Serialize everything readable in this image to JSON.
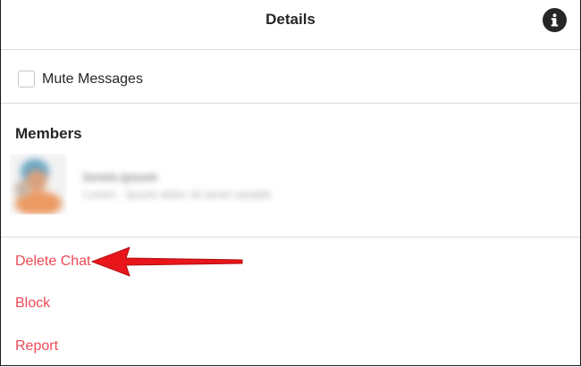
{
  "header": {
    "title": "Details",
    "info_icon": "info-icon"
  },
  "mute": {
    "label": "Mute Messages",
    "checked": false
  },
  "members": {
    "title": "Members",
    "items": [
      {
        "name": "lorem.ipsum",
        "subtitle": "Lorem · ipsum dolor sit amet sample",
        "blurred": true
      }
    ]
  },
  "actions": {
    "delete_label": "Delete Chat",
    "block_label": "Block",
    "report_label": "Report",
    "color": "#ed4956"
  },
  "annotation": {
    "arrow_color": "#e8161b",
    "points_to": "Delete Chat"
  }
}
